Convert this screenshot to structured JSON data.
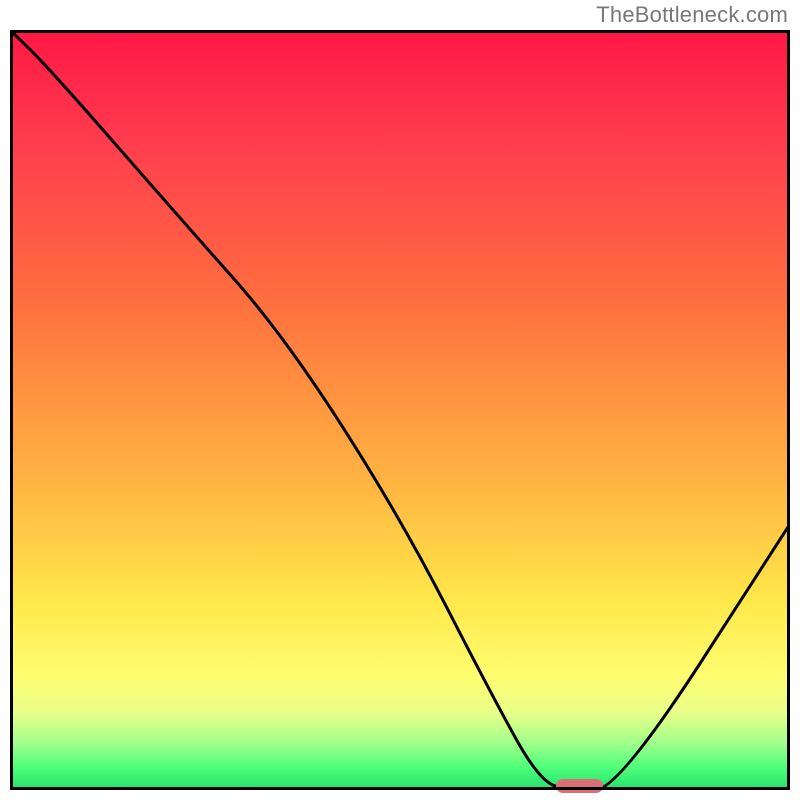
{
  "watermark": "TheBottleneck.com",
  "colors": {
    "frame_border": "#000000",
    "watermark_text": "#777777",
    "marker_fill": "#db6f74",
    "gradient_top": "#ff1744",
    "gradient_bottom": "#24e06b"
  },
  "chart_data": {
    "type": "line",
    "title": "",
    "xlabel": "",
    "ylabel": "",
    "xlim": [
      0,
      100
    ],
    "ylim": [
      0,
      100
    ],
    "grid": false,
    "legend": false,
    "series": [
      {
        "name": "bottleneck-curve",
        "x": [
          0,
          5,
          22,
          35,
          50,
          62,
          68,
          72,
          78,
          100
        ],
        "values": [
          100,
          95,
          75,
          60,
          36,
          12,
          1,
          0,
          0,
          35
        ]
      }
    ],
    "marker": {
      "name": "optimal-range",
      "x_start": 70,
      "x_end": 76,
      "y": 0
    }
  }
}
